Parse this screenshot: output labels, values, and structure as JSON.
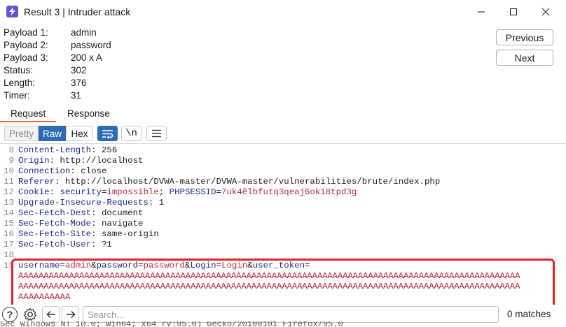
{
  "window": {
    "title": "Result 3 | Intruder attack",
    "minimize_glyph": "—",
    "maximize_glyph": "☐",
    "close_glyph": "✕",
    "brand_color": "#5e58d6"
  },
  "info": {
    "rows": [
      {
        "label": "Payload 1:",
        "value": "admin"
      },
      {
        "label": "Payload 2:",
        "value": "password"
      },
      {
        "label": "Payload 3:",
        "value": "200 x A"
      },
      {
        "label": "Status:",
        "value": "302"
      },
      {
        "label": "Length:",
        "value": "376"
      },
      {
        "label": "Timer:",
        "value": "31"
      }
    ],
    "previous_label": "Previous",
    "next_label": "Next"
  },
  "tabs": [
    {
      "label": "Request",
      "active": true
    },
    {
      "label": "Response",
      "active": false
    }
  ],
  "toolbar": {
    "pretty_label": "Pretty",
    "raw_label": "Raw",
    "hex_label": "Hex",
    "newline_label": "\\n",
    "active_color": "#2d6bb3"
  },
  "editor": {
    "lines": [
      {
        "n": "8",
        "key": "Content-Length",
        "val": " 256"
      },
      {
        "n": "9",
        "key": "Origin",
        "val": " http://localhost"
      },
      {
        "n": "10",
        "key": "Connection",
        "val": " close"
      },
      {
        "n": "11",
        "key": "Referer",
        "val": " http://localhost/DVWA-master/DVWA-master/vulnerabilities/brute/index.php"
      },
      {
        "n": "12",
        "key": "Cookie",
        "val": " "
      },
      {
        "n": "13",
        "key": "Upgrade-Insecure-Requests",
        "val": " 1"
      },
      {
        "n": "14",
        "key": "Sec-Fetch-Dest",
        "val": " document"
      },
      {
        "n": "15",
        "key": "Sec-Fetch-Mode",
        "val": " navigate"
      },
      {
        "n": "16",
        "key": "Sec-Fetch-Site",
        "val": " same-origin"
      },
      {
        "n": "17",
        "key": "Sec-Fetch-User",
        "val": " ?1"
      },
      {
        "n": "18",
        "key": "",
        "val": ""
      }
    ],
    "cookie": {
      "security_key": "security",
      "security_val": "impossible",
      "sessid_key": "PHPSESSID",
      "sessid_val": "7uk4ẽlbfutq3qeaj6ok18tpd3g"
    },
    "body": {
      "n": "19",
      "username_key": "username",
      "username_val": "admin",
      "password_key": "password",
      "password_val": "password",
      "login_key": "Login",
      "login_val": "Login",
      "token_key": "user_token",
      "token_line1": "AAAAAAAAAAAAAAAAAAAAAAAAAAAAAAAAAAAAAAAAAAAAAAAAAAAAAAAAAAAAAAAAAAAAAAAAAAAAAAAAAAAAAAAAAAAAAAAAAAA",
      "token_line2": "AAAAAAAAAAAAAAAAAAAAAAAAAAAAAAAAAAAAAAAAAAAAAAAAAAAAAAAAAAAAAAAAAAAAAAAAAAAAAAAAAAAAAAAAAAAAAAAAAAA",
      "token_line3": "AAAAAAAAAA"
    },
    "highlight_color": "#e0242a"
  },
  "search": {
    "placeholder": "Search...",
    "matches": "0 matches"
  },
  "statusline": "Sec Windows NT 10.0; Win64; x64 rv:95.0) Gecko/20100101 Firefox/95.0"
}
